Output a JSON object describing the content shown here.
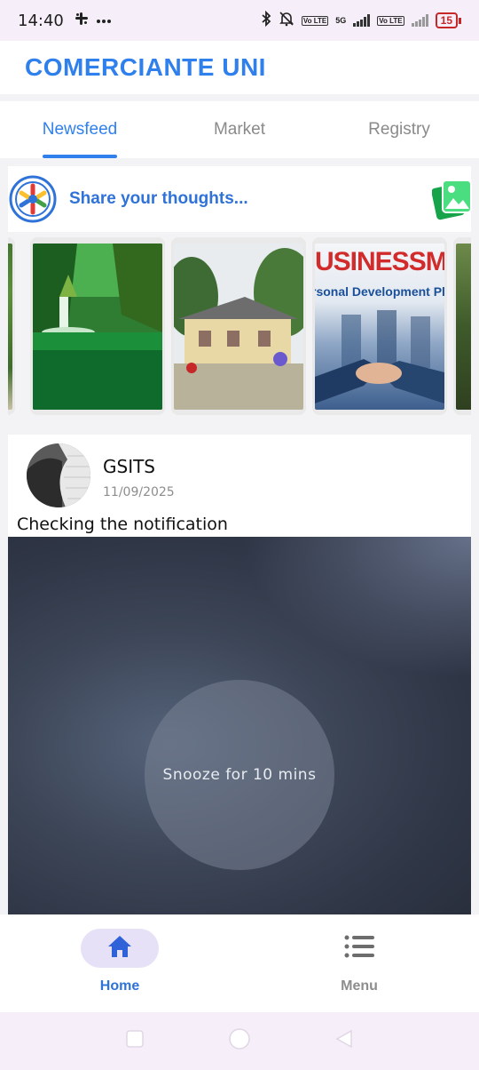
{
  "status_bar": {
    "time": "14:40",
    "left_icons": [
      "slack-icon",
      "more-dots-icon"
    ],
    "right_icons": [
      "bluetooth-icon",
      "bell-off-icon",
      "volte-icon",
      "signal-5g-icon",
      "volte-icon",
      "signal-icon"
    ],
    "network_label": "5G",
    "volte_label": "Vo LTE",
    "battery_level": "15"
  },
  "app_bar": {
    "title": "COMERCIANTE UNI"
  },
  "tabs": [
    {
      "label": "Newsfeed",
      "active": true
    },
    {
      "label": "Market",
      "active": false
    },
    {
      "label": "Registry",
      "active": false
    }
  ],
  "composer": {
    "placeholder": "Share your thoughts...",
    "avatar_icon": "organization-logo-icon",
    "action_icon": "add-photo-icon"
  },
  "stories": [
    {
      "name": "story-forest-partial"
    },
    {
      "name": "story-waterfall"
    },
    {
      "name": "story-house"
    },
    {
      "name": "story-businessman",
      "banner": "USINESSMA",
      "subtitle": "rsonal Development Pl"
    },
    {
      "name": "story-tree-partial"
    }
  ],
  "post": {
    "author": "GSITS",
    "date": "11/09/2025",
    "text": "Checking the notification",
    "image_caption": "Snooze for 10 mins"
  },
  "bottom_nav": [
    {
      "label": "Home",
      "icon": "home-icon",
      "active": true
    },
    {
      "label": "Menu",
      "icon": "menu-list-icon",
      "active": false
    }
  ],
  "colors": {
    "brand": "#2f80ed",
    "tab_indicator": "#2f80ed",
    "nav_active_pill": "#e6e1f7",
    "battery_low": "#c62828",
    "photo_icon_green": "#22c55e"
  }
}
